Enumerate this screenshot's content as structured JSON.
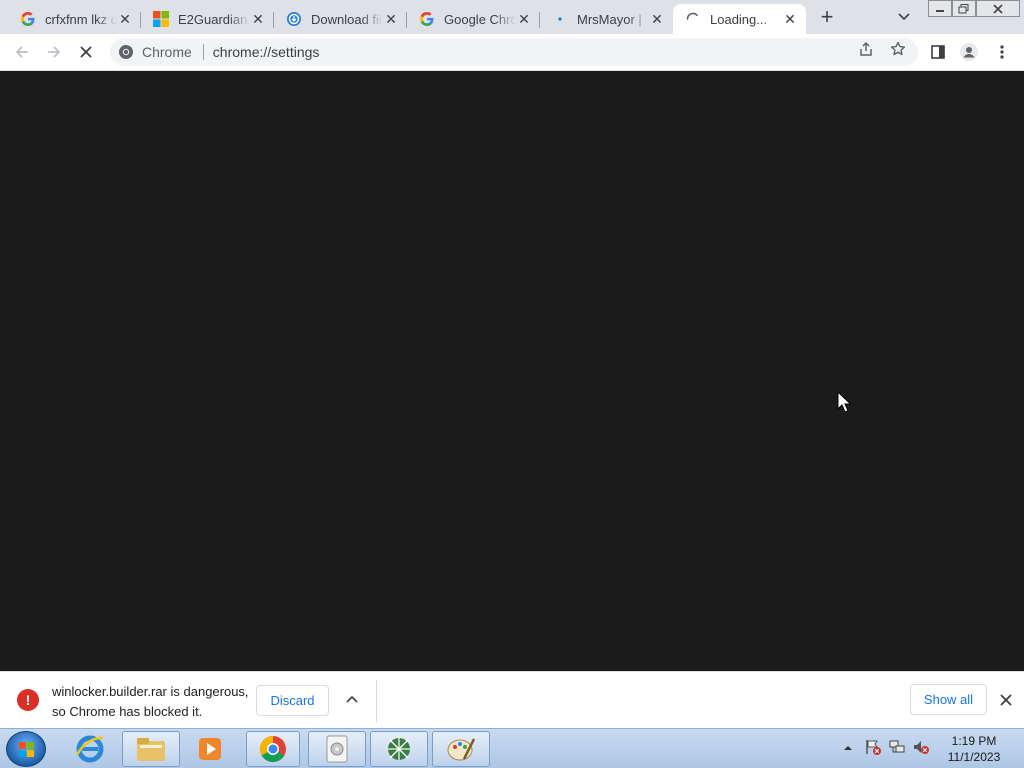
{
  "tabs": [
    {
      "title": "crfxfnm lkz d",
      "favicon": "google-g-icon"
    },
    {
      "title": "E2Guardian -",
      "favicon": "microsoft-logo-icon"
    },
    {
      "title": "Download fil",
      "favicon": "download-site-icon"
    },
    {
      "title": "Google Chro",
      "favicon": "google-g-icon"
    },
    {
      "title": "MrsMayor |",
      "favicon": "loading-dot-icon"
    },
    {
      "title": "Loading...",
      "favicon": "spinner-icon",
      "active": true
    }
  ],
  "omnibox": {
    "site_chip": "Chrome",
    "url": "chrome://settings"
  },
  "download": {
    "line1": "winlocker.builder.rar is dangerous,",
    "line2": "so Chrome has blocked it.",
    "discard_label": "Discard",
    "show_all_label": "Show all"
  },
  "clock": {
    "time": "1:19 PM",
    "date": "11/1/2023"
  },
  "colors": {
    "content_bg": "#1b1b1b",
    "tabstrip_bg": "#dee1e6",
    "danger": "#d93025",
    "link_blue": "#1a73e8"
  }
}
